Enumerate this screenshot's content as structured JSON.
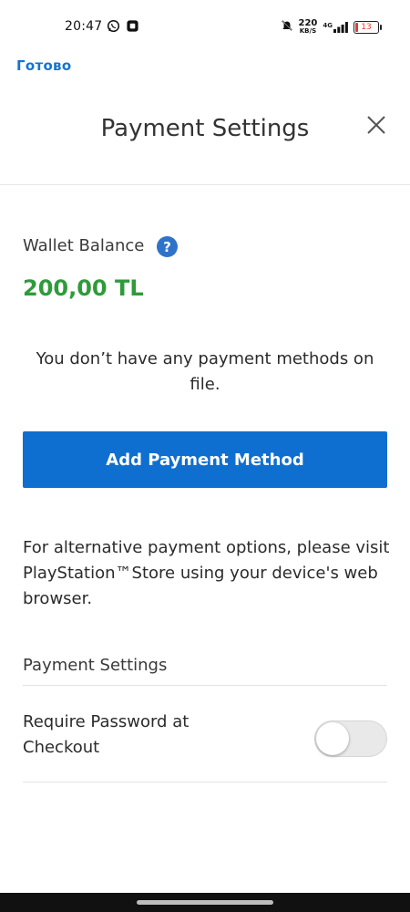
{
  "status_bar": {
    "time": "20:47",
    "net_speed_value": "220",
    "net_speed_unit": "KB/S",
    "network": "4G",
    "battery": "13",
    "icons": [
      "whatsapp-icon",
      "app-icon",
      "mute-icon",
      "signal-icon",
      "battery-icon"
    ]
  },
  "top_link": {
    "label": "Готово"
  },
  "header": {
    "title": "Payment Settings",
    "close_icon": "close-icon"
  },
  "wallet": {
    "label": "Wallet Balance",
    "help_glyph": "?",
    "amount": "200,00 TL",
    "amount_color": "#2e9b3a"
  },
  "payment_methods": {
    "empty_message": "You don’t have any payment methods on file.",
    "add_button_label": "Add Payment Method",
    "accent_color": "#0f6fd0"
  },
  "alternative": {
    "text": "For alternative payment options, please visit PlayStation™Store using your device's web browser."
  },
  "settings": {
    "heading": "Payment Settings",
    "require_password_label": "Require Password at Checkout",
    "require_password_enabled": false
  }
}
